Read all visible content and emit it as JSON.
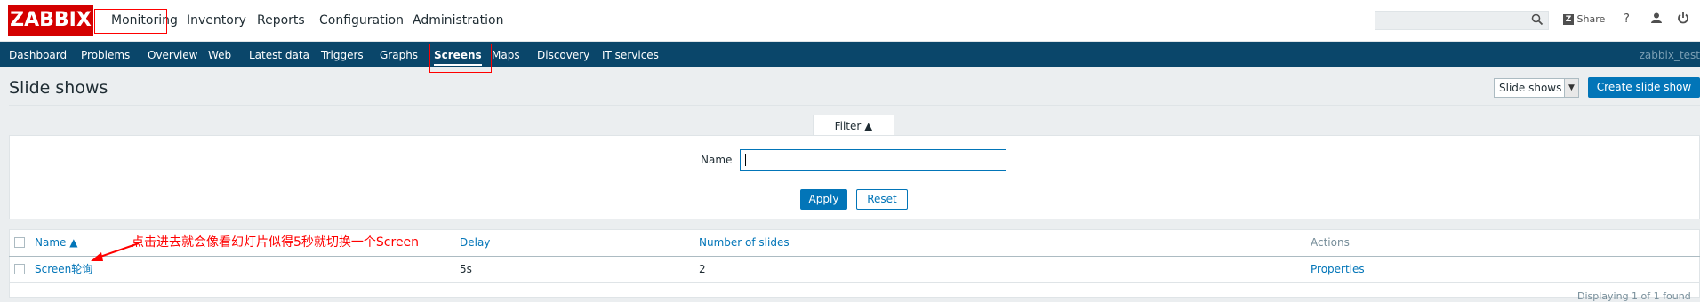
{
  "header": {
    "logo": "ZABBIX",
    "nav": [
      "Monitoring",
      "Inventory",
      "Reports",
      "Configuration",
      "Administration"
    ],
    "search_placeholder": "",
    "share_label": "Share",
    "help_label": "?",
    "user_icon": "user-icon",
    "logout_icon": "power-icon"
  },
  "subnav": {
    "items": [
      "Dashboard",
      "Problems",
      "Overview",
      "Web",
      "Latest data",
      "Triggers",
      "Graphs",
      "Screens",
      "Maps",
      "Discovery",
      "IT services"
    ],
    "selected": "Screens",
    "user": "zabbix_test"
  },
  "page": {
    "title": "Slide shows",
    "view_select": "Slide shows",
    "create_button": "Create slide show"
  },
  "filter": {
    "tab_label": "Filter ▲",
    "name_label": "Name",
    "name_value": "",
    "apply_label": "Apply",
    "reset_label": "Reset"
  },
  "table": {
    "headers": {
      "name": "Name ▲",
      "delay": "Delay",
      "slides": "Number of slides",
      "actions": "Actions"
    },
    "rows": [
      {
        "name": "Screen轮询",
        "delay": "5s",
        "slides": "2",
        "action": "Properties"
      }
    ],
    "footer": "Displaying 1 of 1 found"
  },
  "annotation": {
    "text": "点击进去就会像看幻灯片似得5秒就切换一个Screen",
    "color": "#ff0000"
  },
  "colors": {
    "brand": "#d40000",
    "nav_bg": "#0a466a",
    "accent": "#0275b8",
    "page_bg": "#ebeef0"
  }
}
